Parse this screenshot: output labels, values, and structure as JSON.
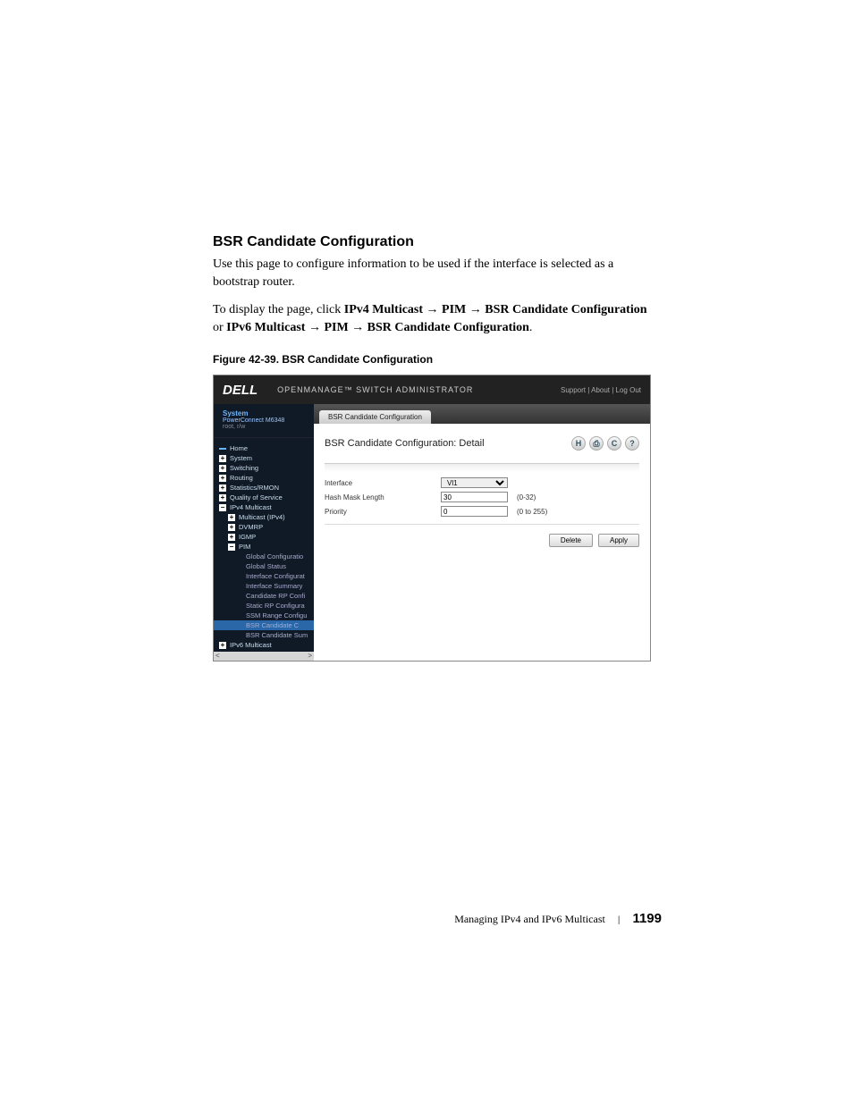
{
  "heading": "BSR Candidate Configuration",
  "para1": "Use this page to configure information to be used if the interface is selected as a bootstrap router.",
  "para2": {
    "lead": "To display the page, click ",
    "b1": "IPv4 Multicast",
    "arrow": " → ",
    "b2": "PIM",
    "b3": "BSR Candidate Configuration",
    "or": " or ",
    "b4": "IPv6 Multicast",
    "b5": "PIM",
    "b6": "BSR Candidate Configuration",
    "dot": "."
  },
  "figure_caption": "Figure 42-39.    BSR Candidate Configuration",
  "screenshot": {
    "logo": "DELL",
    "header_title": "OPENMANAGE™ SWITCH ADMINISTRATOR",
    "header_links": "Support | About | Log Out",
    "system": {
      "title": "System",
      "model": "PowerConnect M6348",
      "user": "root, r/w"
    },
    "tree": {
      "home": "Home",
      "system": "System",
      "switching": "Switching",
      "routing": "Routing",
      "stats": "Statistics/RMON",
      "qos": "Quality of Service",
      "ipv4m": "IPv4 Multicast",
      "multicast": "Multicast (IPv4)",
      "dvmrp": "DVMRP",
      "igmp": "IGMP",
      "pim": "PIM",
      "global_config": "Global Configuratio",
      "global_status": "Global Status",
      "iface_config": "Interface Configurat",
      "iface_summary": "Interface Summary",
      "cand_rp": "Candidate RP Confi",
      "static_rp": "Static RP Configura",
      "ssm": "SSM Range Configu",
      "bsr_cand_c": "BSR Candidate C",
      "bsr_cand_sum": "BSR Candidate Sum",
      "ipv6m": "IPv6 Multicast"
    },
    "tab": "BSR Candidate Configuration",
    "content_title": "BSR Candidate Configuration: Detail",
    "toolbar": {
      "save": "H",
      "print": "⎙",
      "refresh": "C",
      "help": "?"
    },
    "form": {
      "row1": {
        "label": "Interface",
        "value": "Vl1"
      },
      "row2": {
        "label": "Hash Mask Length",
        "value": "30",
        "hint": "(0-32)"
      },
      "row3": {
        "label": "Priority",
        "value": "0",
        "hint": "(0 to 255)"
      }
    },
    "buttons": {
      "delete": "Delete",
      "apply": "Apply"
    }
  },
  "footer": {
    "text": "Managing IPv4 and IPv6 Multicast",
    "page": "1199"
  }
}
